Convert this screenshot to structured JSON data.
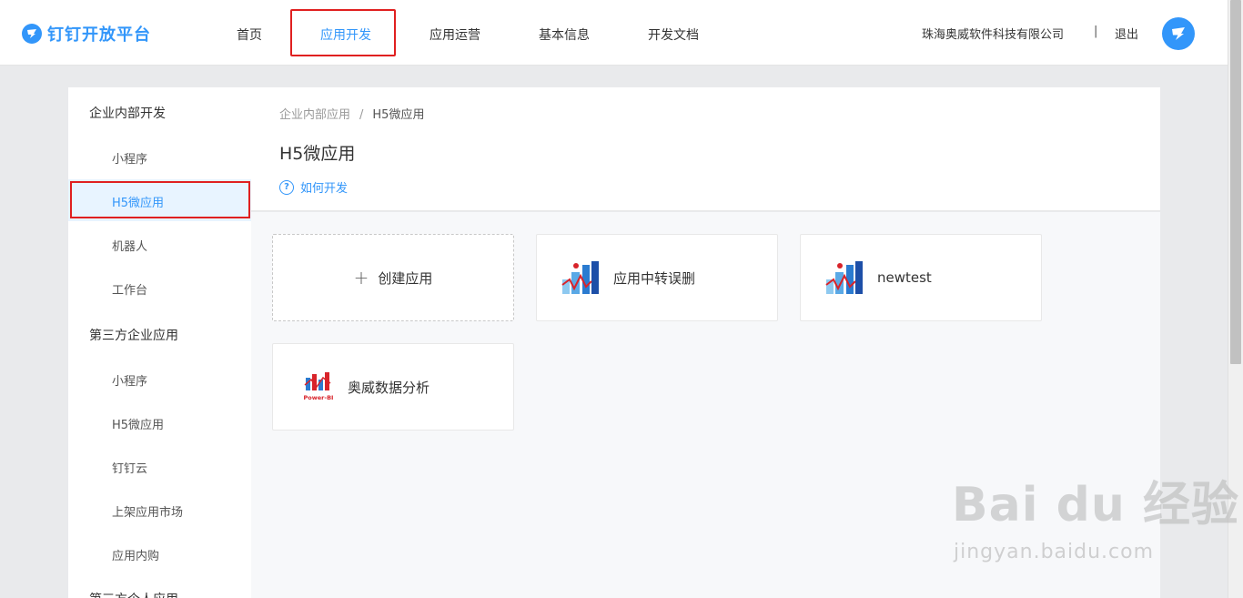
{
  "brand": {
    "name": "钉钉开放平台"
  },
  "nav": {
    "items": [
      {
        "label": "首页"
      },
      {
        "label": "应用开发",
        "active": true
      },
      {
        "label": "应用运营"
      },
      {
        "label": "基本信息"
      },
      {
        "label": "开发文档"
      }
    ]
  },
  "account": {
    "company": "珠海奥威软件科技有限公司",
    "separator": "|",
    "logout": "退出"
  },
  "sidebar": {
    "groups": [
      {
        "title": "企业内部开发",
        "items": [
          "小程序",
          "H5微应用",
          "机器人",
          "工作台"
        ]
      },
      {
        "title": "第三方企业应用",
        "items": [
          "小程序",
          "H5微应用",
          "钉钉云",
          "上架应用市场",
          "应用内购"
        ]
      },
      {
        "title": "第三方个人应用"
      }
    ],
    "active_item": "H5微应用"
  },
  "breadcrumb": {
    "parent": "企业内部应用",
    "separator": "/",
    "current": "H5微应用"
  },
  "page": {
    "title": "H5微应用",
    "help_link": "如何开发",
    "help_icon": "question-circle-icon"
  },
  "apps": {
    "create_label": "创建应用",
    "cards": [
      {
        "name": "应用中转误删",
        "icon": "app-logo-icon"
      },
      {
        "name": "newtest",
        "icon": "app-logo-icon"
      },
      {
        "name": "奥威数据分析",
        "icon": "power-bi-logo-icon",
        "logo_text": "Power-BI"
      }
    ]
  },
  "watermark": {
    "main": "Bai du 经验",
    "sub": "jingyan.baidu.com"
  },
  "colors": {
    "accent": "#3296fa",
    "highlight": "#e02020",
    "active_bg": "#e8f4ff"
  }
}
